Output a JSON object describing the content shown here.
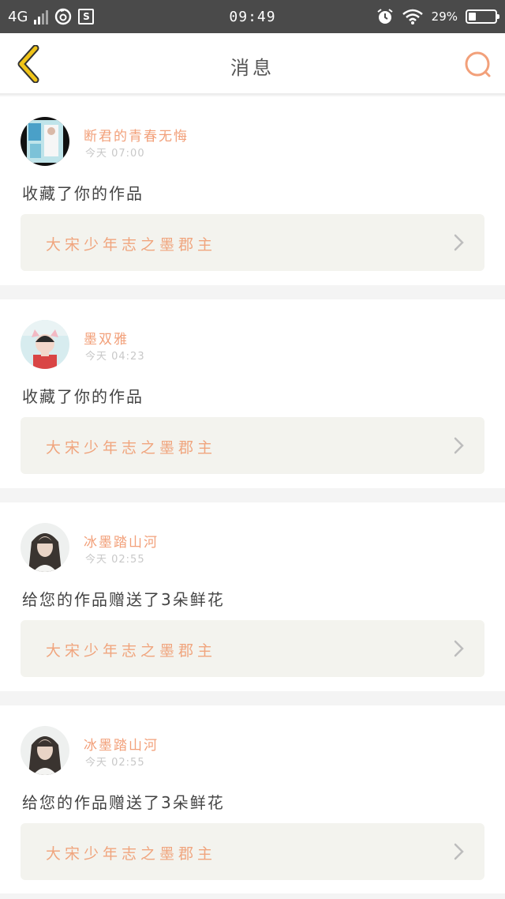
{
  "status_bar": {
    "network": "4G",
    "time": "09:49",
    "battery_percent": "29%",
    "battery_level": 0.29,
    "icons": [
      "signal-icon",
      "netease-music-icon",
      "s-app-icon",
      "alarm-icon",
      "wifi-icon",
      "battery-icon"
    ]
  },
  "header": {
    "title": "消息",
    "back_icon": "chevron-left-icon",
    "search_icon": "search-icon"
  },
  "colors": {
    "accent": "#f2a07a",
    "back_arrow": "#f0c419",
    "card_bg": "#ffffff",
    "page_bg": "#f4f4f4",
    "work_box_bg": "#f3f3ee"
  },
  "messages": [
    {
      "username": "断君的青春无悔",
      "time": "今天 07:00",
      "action": "收藏了你的作品",
      "work_title": "大宋少年志之墨郡主",
      "avatar": "book-cover-avatar"
    },
    {
      "username": "墨双雅",
      "time": "今天 04:23",
      "action": "收藏了你的作品",
      "work_title": "大宋少年志之墨郡主",
      "avatar": "cat-ear-girl-avatar"
    },
    {
      "username": "冰墨踏山河",
      "time": "今天 02:55",
      "action": "给您的作品赠送了3朵鲜花",
      "work_title": "大宋少年志之墨郡主",
      "avatar": "long-hair-man-avatar"
    },
    {
      "username": "冰墨踏山河",
      "time": "今天 02:55",
      "action": "给您的作品赠送了3朵鲜花",
      "work_title": "大宋少年志之墨郡主",
      "avatar": "long-hair-man-avatar"
    }
  ]
}
